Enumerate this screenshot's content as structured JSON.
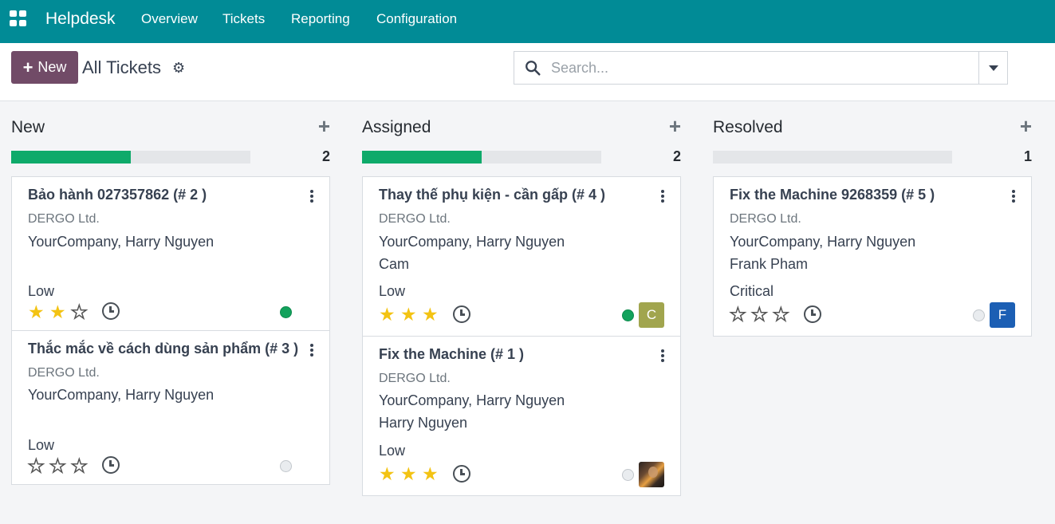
{
  "nav": {
    "app_name": "Helpdesk",
    "items": [
      "Overview",
      "Tickets",
      "Reporting",
      "Configuration"
    ]
  },
  "control": {
    "new_label": "New",
    "breadcrumb": "All Tickets",
    "search_placeholder": "Search..."
  },
  "colors": {
    "navbar": "#018b96",
    "new_button": "#714b67",
    "progress_fill": "#0eaa6a",
    "star": "#f3c313"
  },
  "columns": [
    {
      "title": "New",
      "count": "2",
      "progress_fraction": 0.5,
      "cards": [
        {
          "title": "Bảo hành 027357862 (# 2 )",
          "partner": "DERGO Ltd.",
          "team": "YourCompany, Harry Nguyen",
          "assignee": "",
          "priority": "Low",
          "stars": 2,
          "status": "green",
          "avatar": ""
        },
        {
          "title": "Thắc mắc về cách dùng sản phẩm (# 3 )",
          "partner": "DERGO Ltd.",
          "team": "YourCompany, Harry Nguyen",
          "assignee": "",
          "priority": "Low",
          "stars": 0,
          "status": "grey",
          "avatar": ""
        }
      ]
    },
    {
      "title": "Assigned",
      "count": "2",
      "progress_fraction": 0.5,
      "cards": [
        {
          "title": "Thay thế phụ kiện - cần gấp (# 4 )",
          "partner": "DERGO Ltd.",
          "team": "YourCompany, Harry Nguyen",
          "assignee": "Cam",
          "priority": "Low",
          "stars": 3,
          "status": "green",
          "avatar": "C"
        },
        {
          "title": "Fix the Machine (# 1 )",
          "partner": "DERGO Ltd.",
          "team": "YourCompany, Harry Nguyen",
          "assignee": "Harry Nguyen",
          "priority": "Low",
          "stars": 3,
          "status": "grey",
          "avatar": ""
        }
      ]
    },
    {
      "title": "Resolved",
      "count": "1",
      "progress_fraction": 0,
      "cards": [
        {
          "title": "Fix the Machine 9268359 (# 5 )",
          "partner": "DERGO Ltd.",
          "team": "YourCompany, Harry Nguyen",
          "assignee": "Frank Pham",
          "priority": "Critical",
          "stars": 0,
          "status": "grey",
          "avatar": "F"
        }
      ]
    }
  ]
}
